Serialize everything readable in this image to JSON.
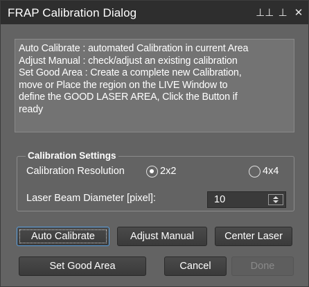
{
  "window": {
    "title": "FRAP Calibration Dialog"
  },
  "info": {
    "lines": [
      "Auto Calibrate : automated Calibration in current Area",
      "Adjust Manual : check/adjust an existing calibration",
      "Set Good Area : Create a complete new Calibration,",
      "move or Place the region on the LIVE Window to",
      "define the GOOD LASER AREA, Click the Button if",
      "ready"
    ]
  },
  "settings": {
    "legend": "Calibration Settings",
    "resolution_label": "Calibration Resolution",
    "resolution_options": [
      "2x2",
      "4x4"
    ],
    "resolution_selected": "2x2",
    "beam_label": "Laser Beam Diameter  [pixel]:",
    "beam_value": "10"
  },
  "buttons": {
    "auto_calibrate": "Auto Calibrate",
    "adjust_manual": "Adjust Manual",
    "center_laser": "Center Laser",
    "set_good_area": "Set Good Area",
    "cancel": "Cancel",
    "done": "Done"
  },
  "colors": {
    "dialog_bg": "#636363",
    "titlebar_bg": "#2e2e2e",
    "focus_border": "#5aa0e0"
  }
}
